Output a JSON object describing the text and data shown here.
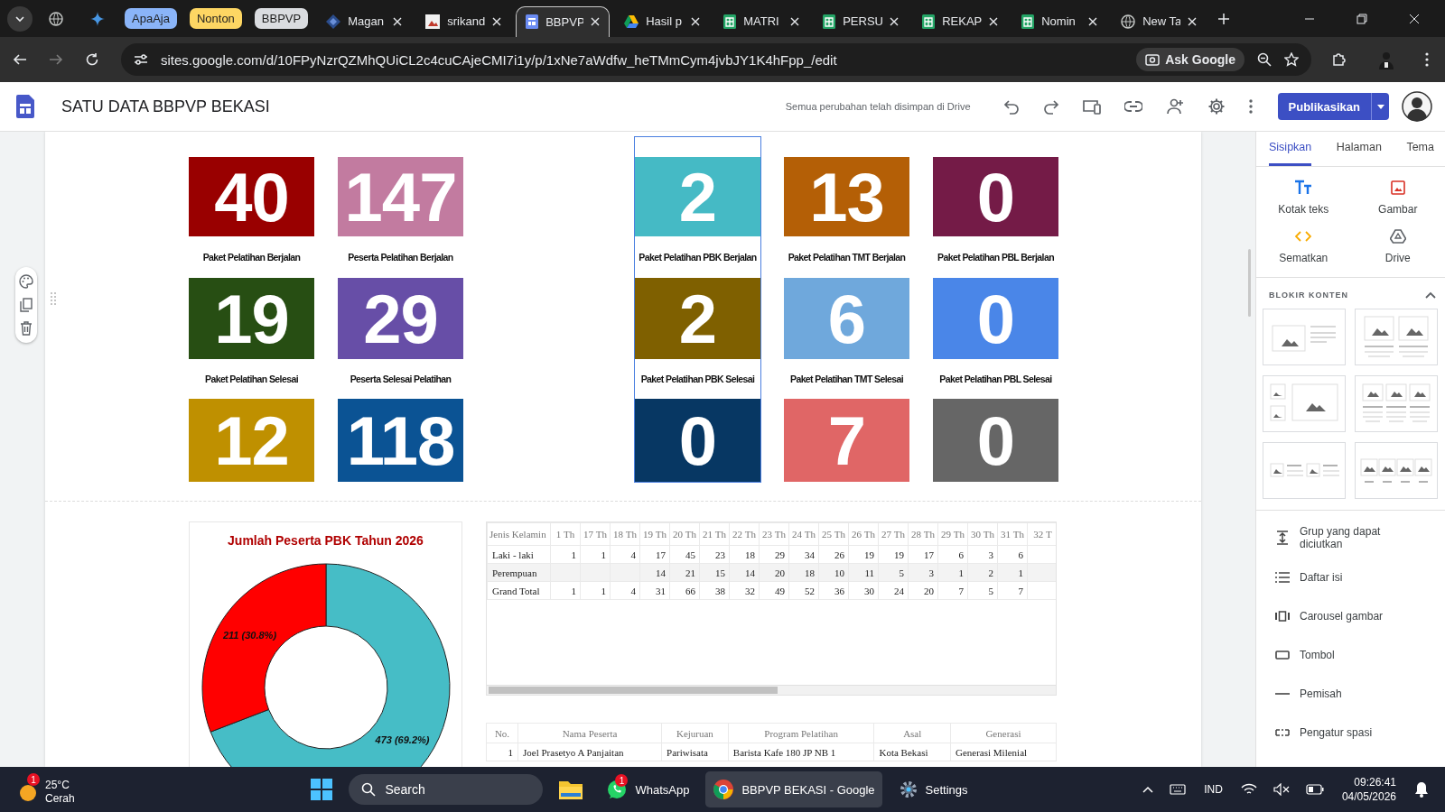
{
  "browser": {
    "tabs": [
      {
        "kind": "globe"
      },
      {
        "kind": "sparkle"
      },
      {
        "kind": "group",
        "label": "ApaAja",
        "color": "#8ab4f8"
      },
      {
        "kind": "group",
        "label": "Nonton",
        "color": "#fdd663"
      },
      {
        "kind": "group",
        "label": "BBPVP",
        "color": "#dadce0"
      },
      {
        "kind": "diamond",
        "label": "Magan",
        "selected": false
      },
      {
        "kind": "picture",
        "label": "srikand",
        "selected": false
      },
      {
        "kind": "site",
        "label": "BBPVP",
        "selected": true
      },
      {
        "kind": "drive",
        "label": "Hasil p",
        "selected": false
      },
      {
        "kind": "sheet",
        "label": "MATRI",
        "selected": false
      },
      {
        "kind": "sheet",
        "label": "PERSU",
        "selected": false
      },
      {
        "kind": "sheet",
        "label": "REKAP",
        "selected": false
      },
      {
        "kind": "sheet",
        "label": "Nomin",
        "selected": false
      },
      {
        "kind": "newtab",
        "label": "New Ta",
        "selected": false
      }
    ],
    "address": "sites.google.com/d/10FPyNzrQZMhQUiCL2c4cuCAjeCMI7i1y/p/1xNe7aWdfw_heTMmCym4jvbJY1K4hFpp_/edit",
    "ask_button": "Ask Google"
  },
  "site_header": {
    "title": "SATU DATA BBPVP BEKASI",
    "save_status": "Semua perubahan telah disimpan di Drive",
    "publish_button": "Publikasikan"
  },
  "stat_columns": [
    {
      "selected": false,
      "tiles": [
        {
          "value": "40",
          "color": "#990000"
        },
        {
          "value": "19",
          "color": "#274e13"
        },
        {
          "value": "12",
          "color": "#bf9000"
        }
      ],
      "labels": [
        "Paket Pelatihan Berjalan",
        "Paket Pelatihan Selesai"
      ]
    },
    {
      "selected": false,
      "tiles": [
        {
          "value": "147",
          "color": "#c27ba0"
        },
        {
          "value": "29",
          "color": "#674ea7"
        },
        {
          "value": "118",
          "color": "#0b5394"
        }
      ],
      "labels": [
        "Peserta Pelatihan Berjalan",
        "Peserta Selesai Pelatihan"
      ]
    },
    {
      "selected": true,
      "tiles": [
        {
          "value": "2",
          "color": "#45bac5"
        },
        {
          "value": "2",
          "color": "#7f6000"
        },
        {
          "value": "0",
          "color": "#073763"
        }
      ],
      "labels": [
        "Paket Pelatihan PBK Berjalan",
        "Paket Pelatihan PBK Selesai"
      ]
    },
    {
      "selected": false,
      "tiles": [
        {
          "value": "13",
          "color": "#b45f06"
        },
        {
          "value": "6",
          "color": "#6fa8dc"
        },
        {
          "value": "7",
          "color": "#e06666"
        }
      ],
      "labels": [
        "Paket Pelatihan TMT Berjalan",
        "Paket Pelatihan TMT Selesai"
      ]
    },
    {
      "selected": false,
      "tiles": [
        {
          "value": "0",
          "color": "#741b47"
        },
        {
          "value": "0",
          "color": "#4a86e8"
        },
        {
          "value": "0",
          "color": "#666666"
        }
      ],
      "labels": [
        "Paket Pelatihan PBL Berjalan",
        "Paket Pelatihan PBL Selesai"
      ]
    }
  ],
  "chart": {
    "chart_data": {
      "type": "donut",
      "title": "Jumlah Peserta PBK Tahun 2026",
      "values": [
        473,
        211
      ],
      "value_labels": [
        "473 (69.2%)",
        "211 (30.8%)"
      ]
    }
  },
  "age_table": {
    "columns": [
      "Jenis Kelamin",
      "1 Th",
      "17 Th",
      "18 Th",
      "19 Th",
      "20 Th",
      "21 Th",
      "22 Th",
      "23 Th",
      "24 Th",
      "25 Th",
      "26 Th",
      "27 Th",
      "28 Th",
      "29 Th",
      "30 Th",
      "31 Th",
      "32 T"
    ],
    "rows": [
      [
        "Laki - laki",
        "1",
        "1",
        "4",
        "17",
        "45",
        "23",
        "18",
        "29",
        "34",
        "26",
        "19",
        "19",
        "17",
        "6",
        "3",
        "6",
        ""
      ],
      [
        "Perempuan",
        "",
        "",
        "",
        "14",
        "21",
        "15",
        "14",
        "20",
        "18",
        "10",
        "11",
        "5",
        "3",
        "1",
        "2",
        "1",
        ""
      ],
      [
        "Grand Total",
        "1",
        "1",
        "4",
        "31",
        "66",
        "38",
        "32",
        "49",
        "52",
        "36",
        "30",
        "24",
        "20",
        "7",
        "5",
        "7",
        ""
      ]
    ]
  },
  "participants_table": {
    "columns": [
      "No.",
      "Nama Peserta",
      "Kejuruan",
      "Program Pelatihan",
      "Asal",
      "Generasi"
    ],
    "rows": [
      [
        "1",
        "Joel Prasetyo A Panjaitan",
        "Pariwisata",
        "Barista Kafe 180 JP NB 1",
        "Kota Bekasi",
        "Generasi Milenial"
      ]
    ]
  },
  "side_panel": {
    "tabs": [
      {
        "label": "Sisipkan",
        "selected": true
      },
      {
        "label": "Halaman",
        "selected": false
      },
      {
        "label": "Tema",
        "selected": false
      }
    ],
    "insert_items": [
      {
        "kind": "text",
        "label": "Kotak teks"
      },
      {
        "kind": "image",
        "label": "Gambar"
      },
      {
        "kind": "embed",
        "label": "Sematkan"
      },
      {
        "kind": "drive",
        "label": "Drive"
      }
    ],
    "content_blocks": {
      "title": "BLOKIR KONTEN",
      "expanded": true,
      "layouts": [
        {
          "kind": "side"
        },
        {
          "kind": "pair"
        },
        {
          "kind": "mosaic"
        },
        {
          "kind": "trio"
        },
        {
          "kind": "inline"
        },
        {
          "kind": "quad"
        }
      ]
    },
    "elements": [
      {
        "kind": "collapse",
        "label": "Grup yang dapat diciutkan"
      },
      {
        "kind": "toc",
        "label": "Daftar isi"
      },
      {
        "kind": "carousel",
        "label": "Carousel gambar"
      },
      {
        "kind": "button",
        "label": "Tombol"
      },
      {
        "kind": "divider",
        "label": "Pemisah"
      },
      {
        "kind": "spacer",
        "label": "Pengatur spasi"
      }
    ]
  },
  "taskbar": {
    "weather": {
      "badge": "1",
      "temp": "25°C",
      "condition": "Cerah"
    },
    "search_placeholder": "Search",
    "apps": [
      {
        "kind": "files",
        "selected": false
      },
      {
        "kind": "whatsapp",
        "label": "WhatsApp",
        "badge": "1",
        "selected": false
      },
      {
        "kind": "chrome",
        "label": "BBPVP BEKASI - Google",
        "selected": true
      },
      {
        "kind": "settings",
        "label": "Settings",
        "selected": false
      }
    ],
    "language": "IND",
    "time": "09:26:41",
    "date": "04/05/2026"
  }
}
